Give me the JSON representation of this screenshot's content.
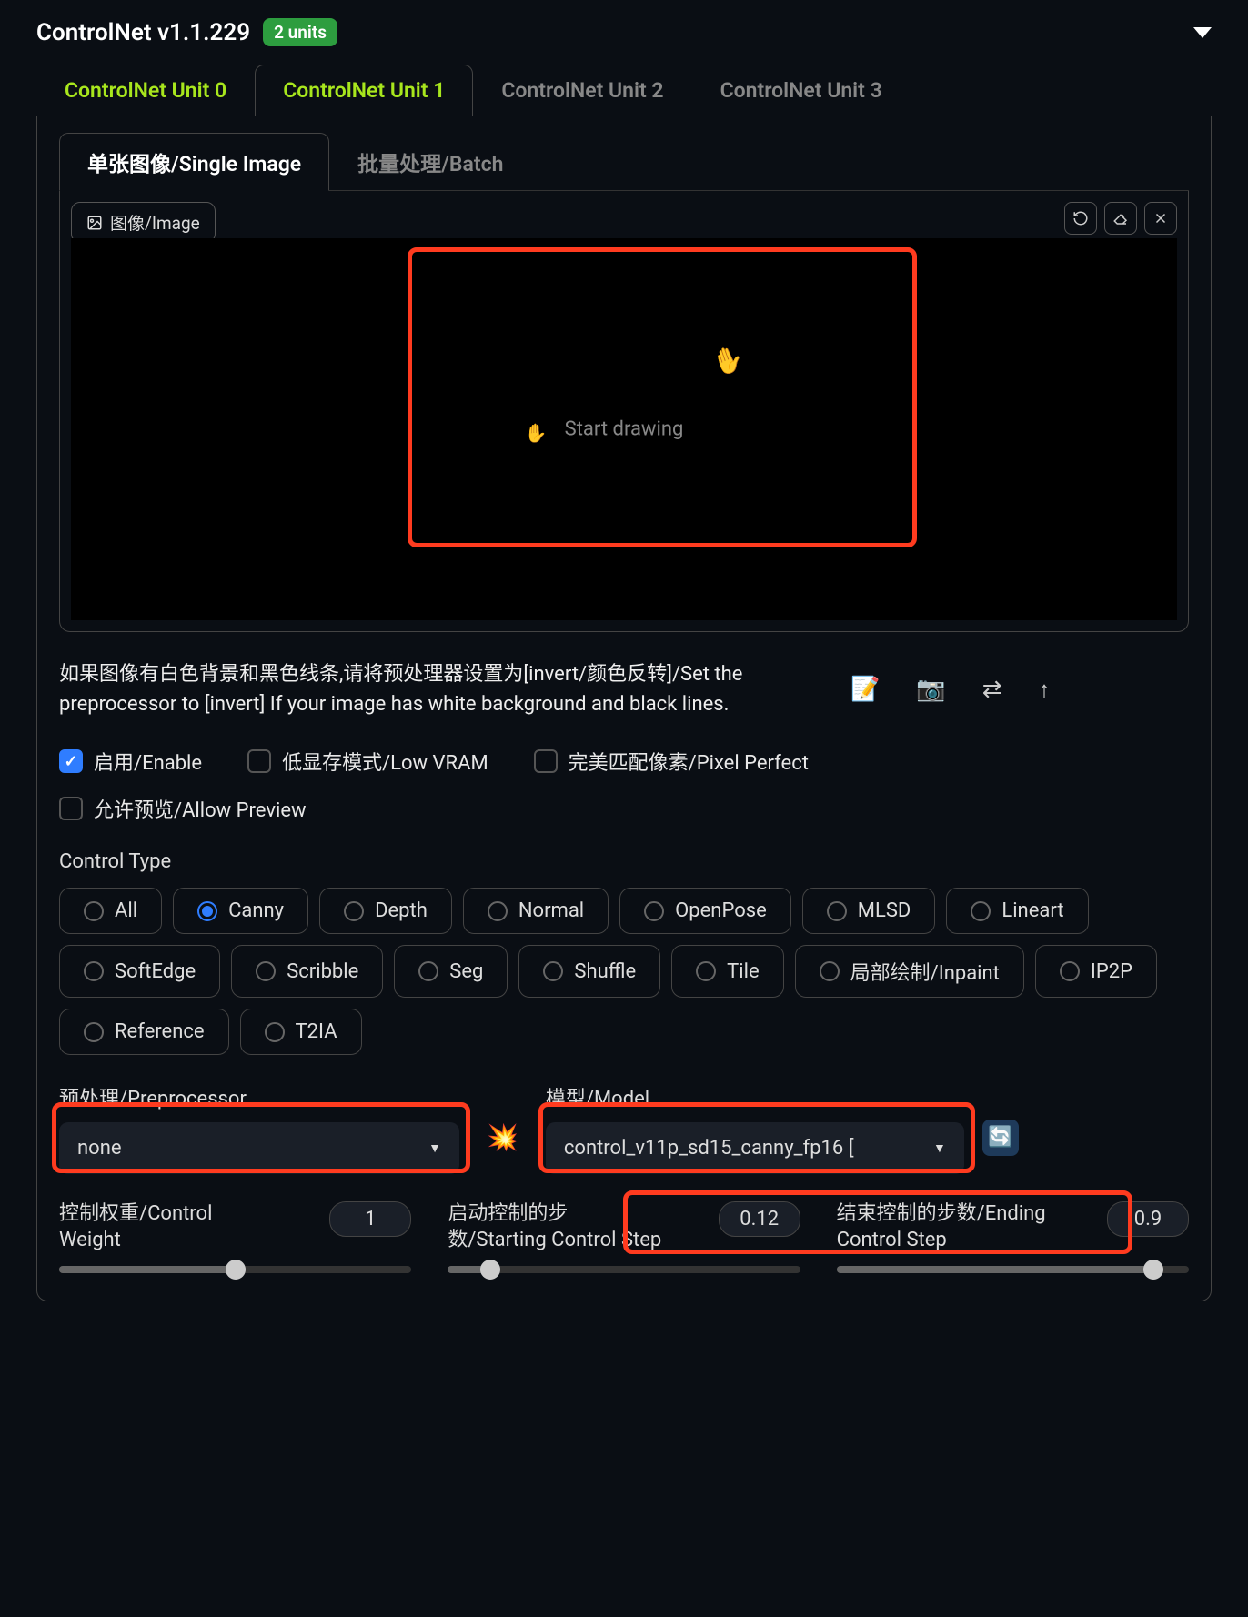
{
  "header": {
    "title": "ControlNet v1.1.229",
    "badge": "2 units"
  },
  "unitTabs": [
    "ControlNet Unit 0",
    "ControlNet Unit 1",
    "ControlNet Unit 2",
    "ControlNet Unit 3"
  ],
  "subTabs": {
    "single": "单张图像/Single Image",
    "batch": "批量处理/Batch"
  },
  "imageTab": "图像/Image",
  "startDrawing": "Start drawing",
  "hint": "如果图像有白色背景和黑色线条,请将预处理器设置为[invert/颜色反转]/Set the preprocessor to [invert] If your image has white background and black lines.",
  "checkboxes": {
    "enable": "启用/Enable",
    "lowvram": "低显存模式/Low VRAM",
    "pixelperfect": "完美匹配像素/Pixel Perfect",
    "allowpreview": "允许预览/Allow Preview"
  },
  "controlTypeLabel": "Control Type",
  "controlTypes": [
    "All",
    "Canny",
    "Depth",
    "Normal",
    "OpenPose",
    "MLSD",
    "Lineart",
    "SoftEdge",
    "Scribble",
    "Seg",
    "Shuffle",
    "Tile",
    "局部绘制/Inpaint",
    "IP2P",
    "Reference",
    "T2IA"
  ],
  "preprocessor": {
    "label": "预处理/Preprocessor",
    "value": "none"
  },
  "model": {
    "label": "模型/Model",
    "value": "control_v11p_sd15_canny_fp16 ["
  },
  "sliders": {
    "weight": {
      "label": "控制权重/Control Weight",
      "value": "1"
    },
    "start": {
      "label": "启动控制的步数/Starting Control Step",
      "value": "0.12"
    },
    "end": {
      "label": "结束控制的步数/Ending Control Step",
      "value": "0.9"
    }
  },
  "icons": {
    "edit": "📝",
    "camera": "📷",
    "swap": "⇄",
    "up": "↑",
    "bang": "💥",
    "refresh": "🔄"
  }
}
